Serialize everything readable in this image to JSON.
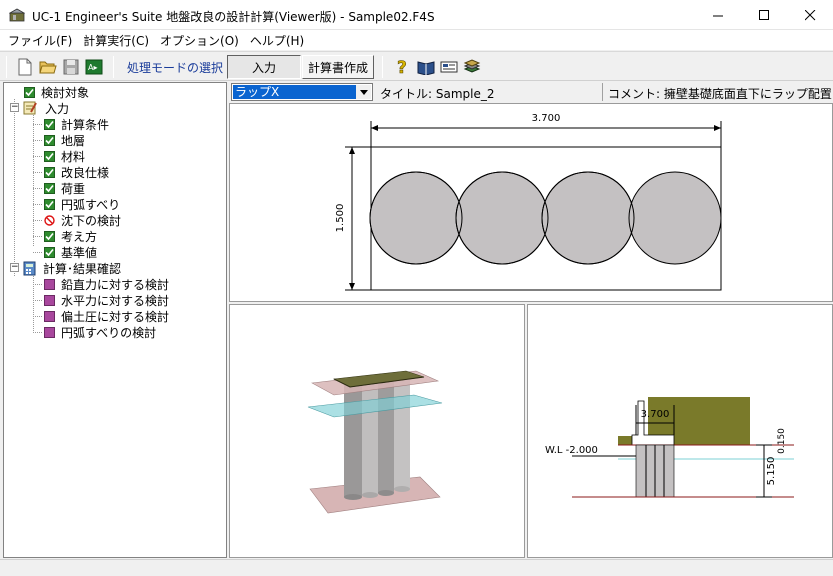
{
  "window": {
    "title": "UC-1 Engineer's Suite 地盤改良の設計計算(Viewer版) - Sample02.F4S",
    "controls": {
      "minimize": "—",
      "maximize": "☐",
      "close": "✕"
    }
  },
  "menu": [
    "ファイル(F)",
    "計算実行(C)",
    "オプション(O)",
    "ヘルプ(H)"
  ],
  "toolbar": {
    "icons": [
      "new-file-icon",
      "open-folder-icon",
      "save-icon",
      "export-icon",
      "help-icon",
      "manual-icon",
      "card-icon",
      "books-icon"
    ],
    "mode_label": "処理モードの選択",
    "input_label": "入力",
    "report_label": "計算書作成"
  },
  "tree": {
    "root": "検討対象",
    "input_group": "入力",
    "input_items": [
      {
        "label": "計算条件",
        "state": "checked"
      },
      {
        "label": "地層",
        "state": "checked"
      },
      {
        "label": "材料",
        "state": "checked"
      },
      {
        "label": "改良仕様",
        "state": "checked"
      },
      {
        "label": "荷重",
        "state": "checked"
      },
      {
        "label": "円弧すべり",
        "state": "checked"
      },
      {
        "label": "沈下の検討",
        "state": "forbidden"
      },
      {
        "label": "考え方",
        "state": "checked"
      },
      {
        "label": "基準値",
        "state": "checked"
      }
    ],
    "result_group": "計算･結果確認",
    "result_items": [
      "鉛直力に対する検討",
      "水平力に対する検討",
      "偏土圧に対する検討",
      "円弧すべりの検討"
    ]
  },
  "view_header": {
    "layout_select": "ラップX",
    "title": "タイトル: Sample_2",
    "comment": "コメント: 擁壁基礎底面直下にラップ配置とす"
  },
  "plan_view": {
    "width_dim": "3.700",
    "height_dim": "1.500",
    "column_count": 4
  },
  "section_view": {
    "width_dim": "3.700",
    "water_level": "W.L -2.000",
    "depth_dim": "5.150",
    "top_dim": "0.150"
  },
  "colors": {
    "selection": "#0a64d0",
    "checkbox_green": "#2e8b2e",
    "result_purple": "#a8479d",
    "circle_fill": "#c4c1c2",
    "soil_olive": "#7a7a2a",
    "water_cyan": "#7ed0d6",
    "ground_line": "#8b1a1a"
  }
}
